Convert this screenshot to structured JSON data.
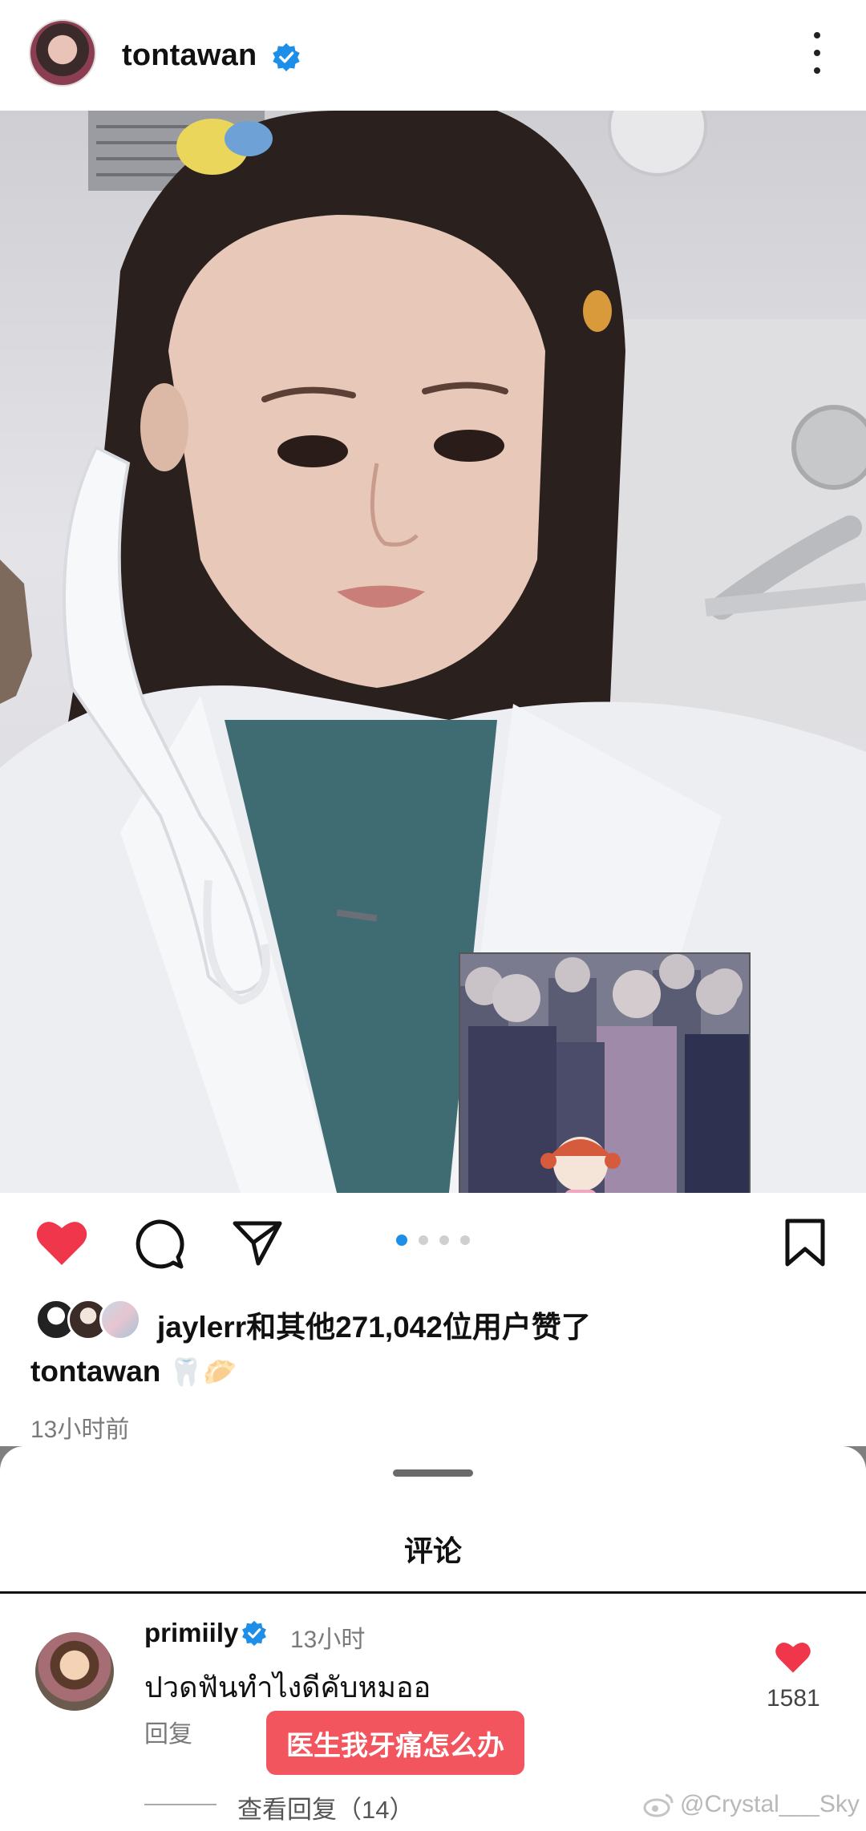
{
  "header": {
    "username": "tontawan",
    "verified": true,
    "menu_icon": "more-vertical-icon"
  },
  "post": {
    "carousel": {
      "total": 4,
      "active_index": 0,
      "accent": "#1d8fe8"
    },
    "liked": true,
    "heart_color": "#f0364a",
    "likes_text": "jaylerr和其他271,042位用户赞了",
    "caption_user": "tontawan",
    "caption_text": "🦷🥟",
    "time_ago": "13小时前"
  },
  "comments_sheet": {
    "title": "评论",
    "comments": [
      {
        "user": "primiily",
        "verified": true,
        "time": "13小时",
        "text": "ปวดฟันทำไงดีคับหมออ",
        "reply_label": "回复",
        "translation": "医生我牙痛怎么办",
        "like_count": "1581",
        "view_replies": "查看回复（14）"
      }
    ]
  },
  "watermark": "@Crystal___Sky"
}
